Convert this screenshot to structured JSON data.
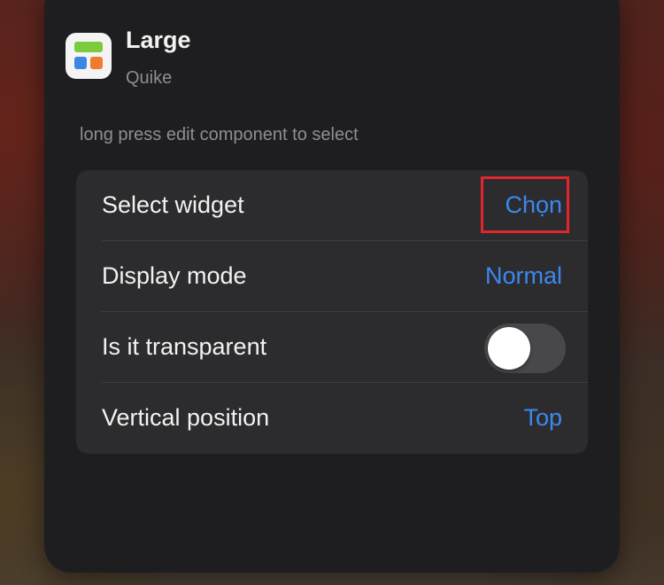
{
  "app": {
    "name": "Large",
    "developer": "Quike",
    "icon": "widget-app-icon"
  },
  "hint": "long press edit component to select",
  "settings": {
    "select_widget": {
      "label": "Select widget",
      "value": "Chọn"
    },
    "display_mode": {
      "label": "Display mode",
      "value": "Normal"
    },
    "transparent": {
      "label": "Is it transparent",
      "toggle_on": false
    },
    "vertical_position": {
      "label": "Vertical position",
      "value": "Top"
    }
  },
  "colors": {
    "accent": "#3c88f0",
    "card_bg": "#1e1e20",
    "group_bg": "#2c2c2e",
    "highlight": "#e0262d"
  }
}
